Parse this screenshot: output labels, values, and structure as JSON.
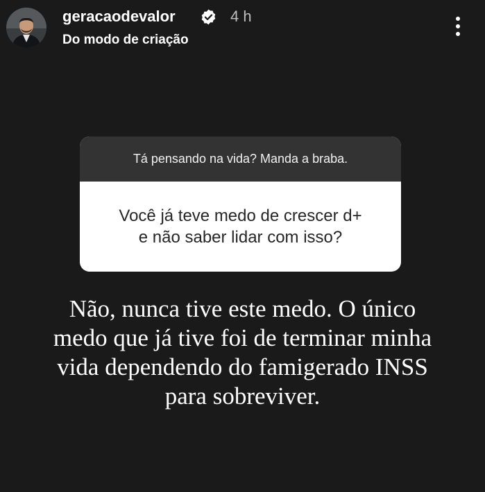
{
  "header": {
    "username": "geracaodevalor",
    "verified_icon": "verified-badge-icon",
    "time": "4 h",
    "subtitle": "Do modo de criação",
    "more_icon": "more-vertical-icon"
  },
  "question_sticker": {
    "prompt": "Tá pensando na vida? Manda a braba.",
    "answer_lines": [
      "Você já teve medo de crescer d+",
      "e não saber lidar com isso?"
    ]
  },
  "story_text": {
    "lines": [
      "Não, nunca tive este medo. O único",
      "medo que já tive foi de terminar minha",
      "vida dependendo do famigerado INSS",
      "para sobreviver."
    ]
  },
  "colors": {
    "background": "#1a1a1a",
    "card_header": "#333333",
    "card_body": "#ffffff",
    "verified_badge": "#ffffff"
  }
}
